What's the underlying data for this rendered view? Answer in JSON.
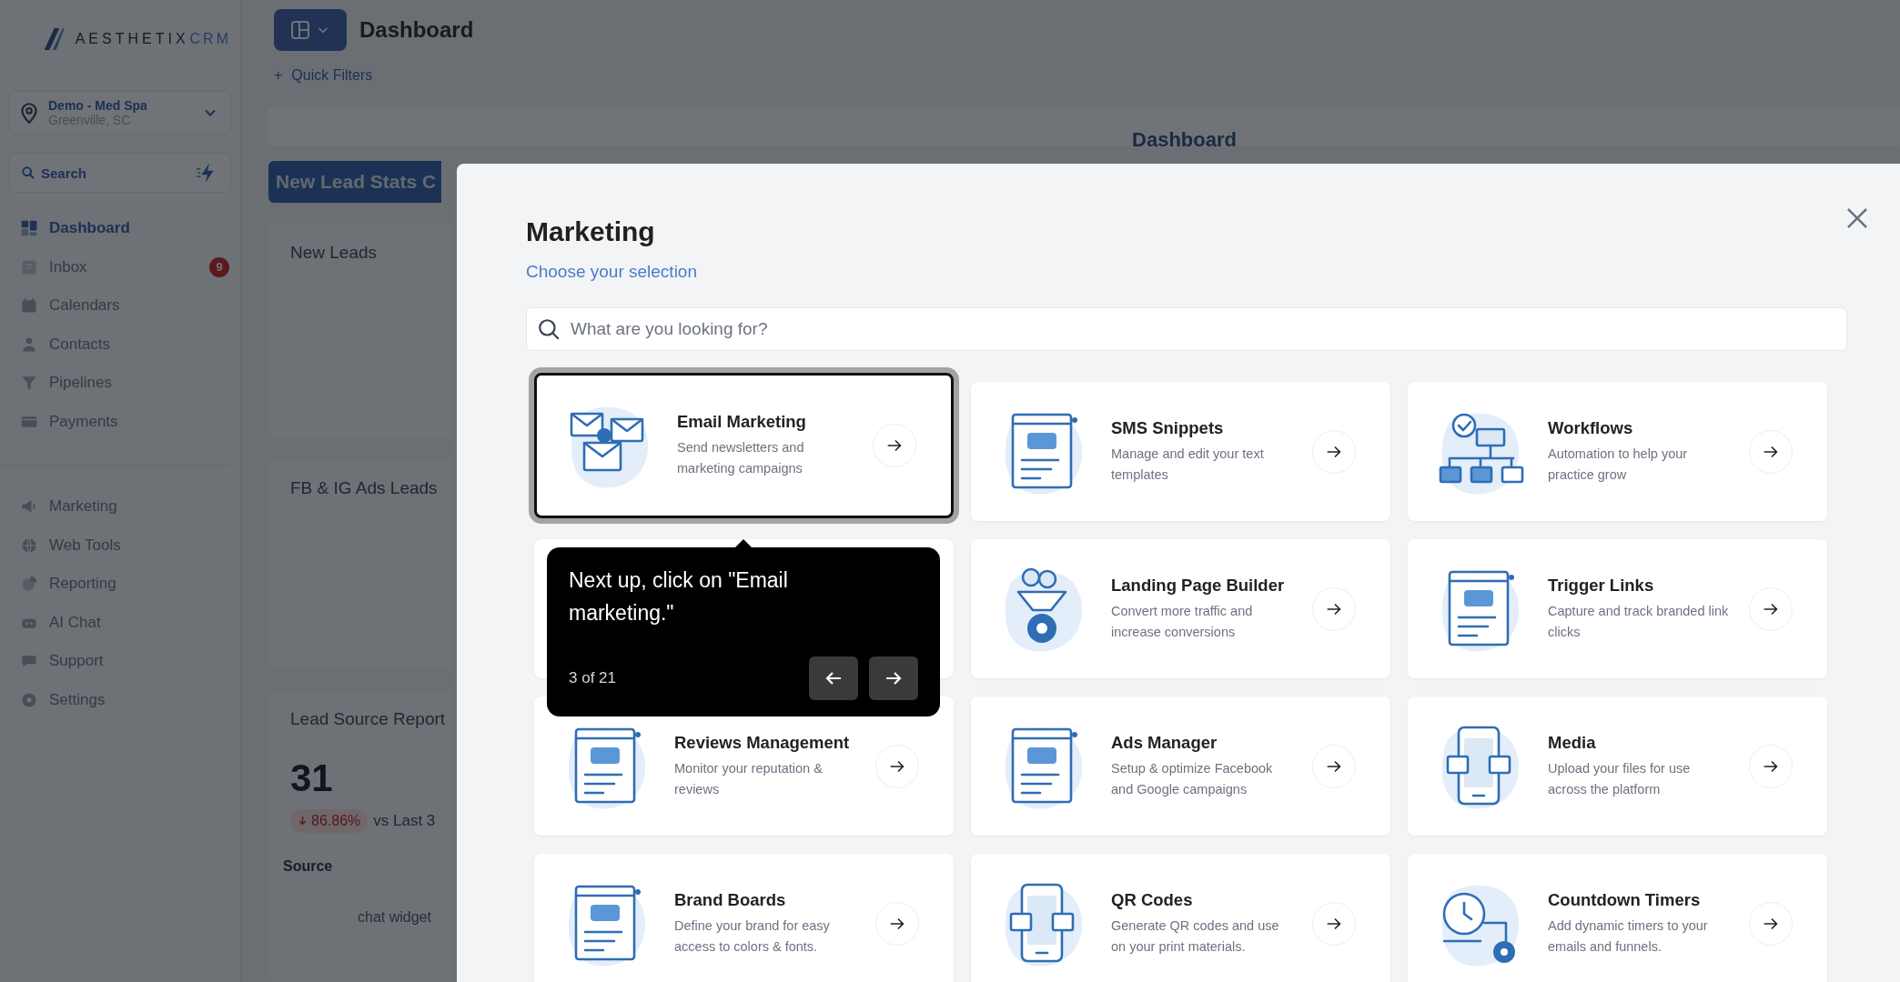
{
  "sidebar": {
    "logo": {
      "text": "AESTHETIX",
      "accent": "CRM"
    },
    "location": {
      "name": "Demo - Med Spa",
      "city": "Greenville, SC"
    },
    "search": {
      "placeholder": "Search"
    },
    "nav": [
      {
        "label": "Dashboard",
        "selected": true
      },
      {
        "label": "Inbox",
        "selected": false,
        "badge": "9"
      },
      {
        "label": "Calendars",
        "selected": false
      },
      {
        "label": "Contacts",
        "selected": false
      },
      {
        "label": "Pipelines",
        "selected": false
      },
      {
        "label": "Payments",
        "selected": false
      }
    ],
    "nav_secondary": [
      {
        "label": "Marketing",
        "selected": false
      },
      {
        "label": "Web Tools",
        "selected": false
      },
      {
        "label": "Reporting",
        "selected": false
      },
      {
        "label": "AI Chat",
        "selected": false
      },
      {
        "label": "Support",
        "selected": false
      },
      {
        "label": "Settings",
        "selected": false
      }
    ]
  },
  "header": {
    "title": "Dashboard",
    "quick_filters": "Quick Filters",
    "plus": "+",
    "page_title": "Dashboard"
  },
  "dashboard": {
    "stats_button": "New Lead Stats C",
    "new_leads": "New Leads",
    "ads_leads": "FB & IG Ads Leads",
    "lead_source": {
      "title": "Lead Source Report",
      "total": "31",
      "change": "86.86%",
      "compare": "vs Last 3",
      "column": "Source",
      "row": "chat widget"
    }
  },
  "modal": {
    "title": "Marketing",
    "subtitle": "Choose your selection",
    "search": {
      "placeholder": "What are you looking for?"
    },
    "cards": [
      {
        "kind": "service",
        "title": "Email Marketing",
        "description": "Send newsletters and marketing campaigns",
        "highlighted": true
      },
      {
        "kind": "service",
        "title": "SMS Snippets",
        "description": "Manage and edit your text templates",
        "highlighted": false
      },
      {
        "kind": "service",
        "title": "Workflows",
        "description": "Automation to help your practice grow",
        "highlighted": false
      },
      {
        "kind": "covered"
      },
      {
        "kind": "service",
        "title": "Landing Page Builder",
        "description": "Convert more traffic and increase conversions",
        "highlighted": false
      },
      {
        "kind": "service",
        "title": "Trigger Links",
        "description": "Capture and track branded link clicks",
        "highlighted": false
      },
      {
        "kind": "service",
        "title": "Reviews Management",
        "description": "Monitor your reputation & reviews",
        "highlighted": false
      },
      {
        "kind": "service",
        "title": "Ads Manager",
        "description": "Setup & optimize Facebook and Google campaigns",
        "highlighted": false
      },
      {
        "kind": "service",
        "title": "Media",
        "description": "Upload your files for use across the platform",
        "highlighted": false
      },
      {
        "kind": "service",
        "title": "Brand Boards",
        "description": "Define your brand for easy access to colors & fonts.",
        "highlighted": false
      },
      {
        "kind": "service",
        "title": "QR Codes",
        "description": "Generate QR codes and use on your print materials.",
        "highlighted": false
      },
      {
        "kind": "service",
        "title": "Countdown Timers",
        "description": "Add dynamic timers to your emails and funnels.",
        "highlighted": false
      }
    ]
  },
  "tour": {
    "text": "Next up, click on \"Email marketing.\"",
    "step": "3 of 21"
  }
}
